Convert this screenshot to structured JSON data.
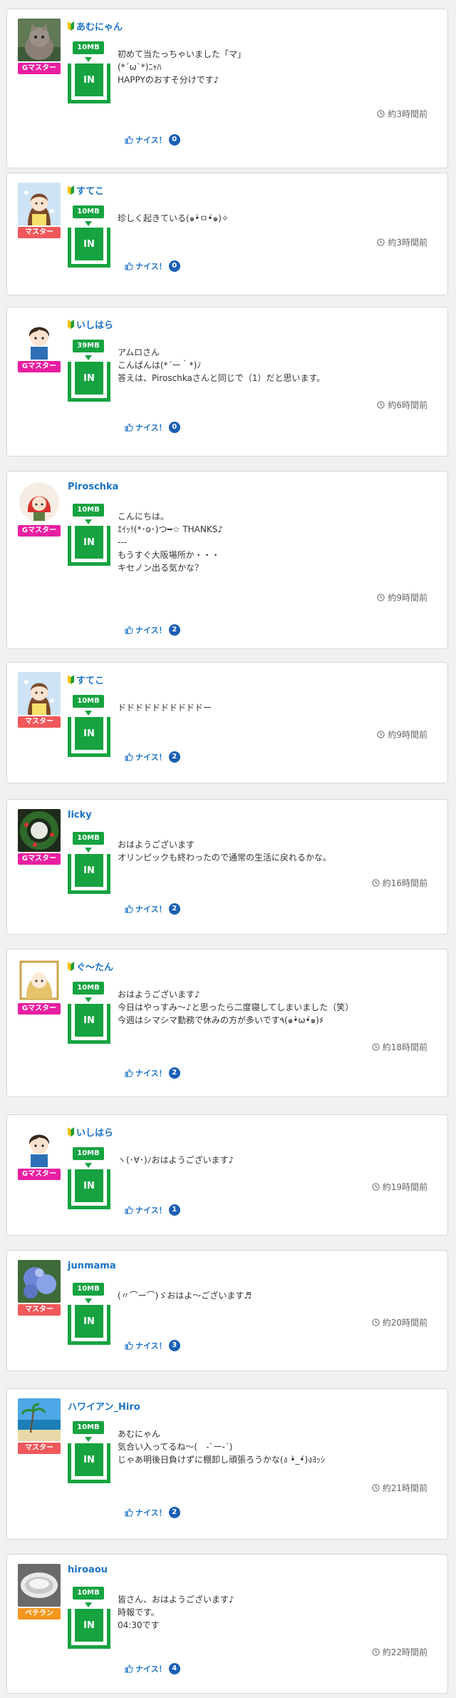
{
  "labels": {
    "in_button": "IN",
    "nice_label": "ナイス！"
  },
  "colors": {
    "accent_green": "#16a340",
    "link_blue": "#1a73c6",
    "count_blue": "#1a5fb4",
    "rank_gmaster": "#e91ea0",
    "rank_master": "#f0585b",
    "rank_veteran": "#f5961e"
  },
  "posts": [
    {
      "username": "あむにゃん",
      "beginner": true,
      "avatar": "cat-photo",
      "rank": "Gマスター",
      "rank_color": "#e91ea0",
      "size": "10MB",
      "message": "初めて当たっちゃいました「マ」\n(*´ω`*)ﾆｬﾊ\nHAPPYのおすそ分けです♪",
      "time": "約3時間前",
      "nice_count": "0"
    },
    {
      "username": "すてこ",
      "beginner": true,
      "avatar": "girl-illustration",
      "rank": "マスター",
      "rank_color": "#f0585b",
      "size": "10MB",
      "message": "珍しく起きている(๑•̀ㅁ•́๑)✧",
      "time": "約3時間前",
      "nice_count": "0"
    },
    {
      "username": "いしはら",
      "beginner": true,
      "avatar": "boy-illustration",
      "rank": "Gマスター",
      "rank_color": "#e91ea0",
      "size": "39MB",
      "message": "アムロさん\nこんばんは(*´ー｀*)ﾉ\n答えは、Piroschkaさんと同じで（1）だと思います。",
      "time": "約6時間前",
      "nice_count": "0"
    },
    {
      "username": "Piroschka",
      "beginner": false,
      "avatar": "red-hood-illustration",
      "rank": "Gマスター",
      "rank_color": "#e91ea0",
      "size": "10MB",
      "message": "こんにちは。\nｴｲｯ!(*･o･)つ━☆ THANKS♪\n---\nもうすぐ大阪場所か・・・\nキセノン出る気かな？",
      "time": "約9時間前",
      "nice_count": "2"
    },
    {
      "username": "すてこ",
      "beginner": true,
      "avatar": "girl-illustration",
      "rank": "マスター",
      "rank_color": "#f0585b",
      "size": "10MB",
      "message": "ドドドドドドドドドドー",
      "time": "約9時間前",
      "nice_count": "2"
    },
    {
      "username": "licky",
      "beginner": false,
      "avatar": "wreath-photo",
      "rank": "Gマスター",
      "rank_color": "#e91ea0",
      "size": "10MB",
      "message": "おはようございます\nオリンピックも終わったので通常の生活に戻れるかな。",
      "time": "約16時間前",
      "nice_count": "2"
    },
    {
      "username": "ぐ～たん",
      "beginner": true,
      "avatar": "anime-girl-illustration",
      "rank": "Gマスター",
      "rank_color": "#e91ea0",
      "size": "10MB",
      "message": "おはようございます♪\n今日はやっすみ～♪と思ったら二度寝してしまいました（笑）\n今週はシマシマ勤務で休みの方が多いです٩(๑•̀ω•́๑)۶",
      "time": "約18時間前",
      "nice_count": "2"
    },
    {
      "username": "いしはら",
      "beginner": true,
      "avatar": "boy-illustration",
      "rank": "Gマスター",
      "rank_color": "#e91ea0",
      "size": "10MB",
      "message": "ヽ(･∀･)ﾉおはようございます♪",
      "time": "約19時間前",
      "nice_count": "1"
    },
    {
      "username": "junmama",
      "beginner": false,
      "avatar": "hydrangea-photo",
      "rank": "マスター",
      "rank_color": "#f0585b",
      "size": "10MB",
      "message": "(〃⌒ー⌒)ゞおはよ～ございます♬",
      "time": "約20時間前",
      "nice_count": "3"
    },
    {
      "username": "ハワイアン_Hiro",
      "beginner": false,
      "avatar": "beach-photo",
      "rank": "マスター",
      "rank_color": "#f0585b",
      "size": "10MB",
      "message": "あむにゃん\n気合い入ってるね～(　-`ー-´)\nじゃあ明後日負けずに棚卸し頑張ろうかな(ง •̀_•́)งﾖｯｼ",
      "time": "約21時間前",
      "nice_count": "2"
    },
    {
      "username": "hiroaou",
      "beginner": false,
      "avatar": "bowl-photo",
      "rank": "ベテラン",
      "rank_color": "#f5961e",
      "size": "10MB",
      "message": "皆さん、おはようございます♪\n時報です。\n04:30です",
      "time": "約22時間前",
      "nice_count": "4"
    }
  ]
}
